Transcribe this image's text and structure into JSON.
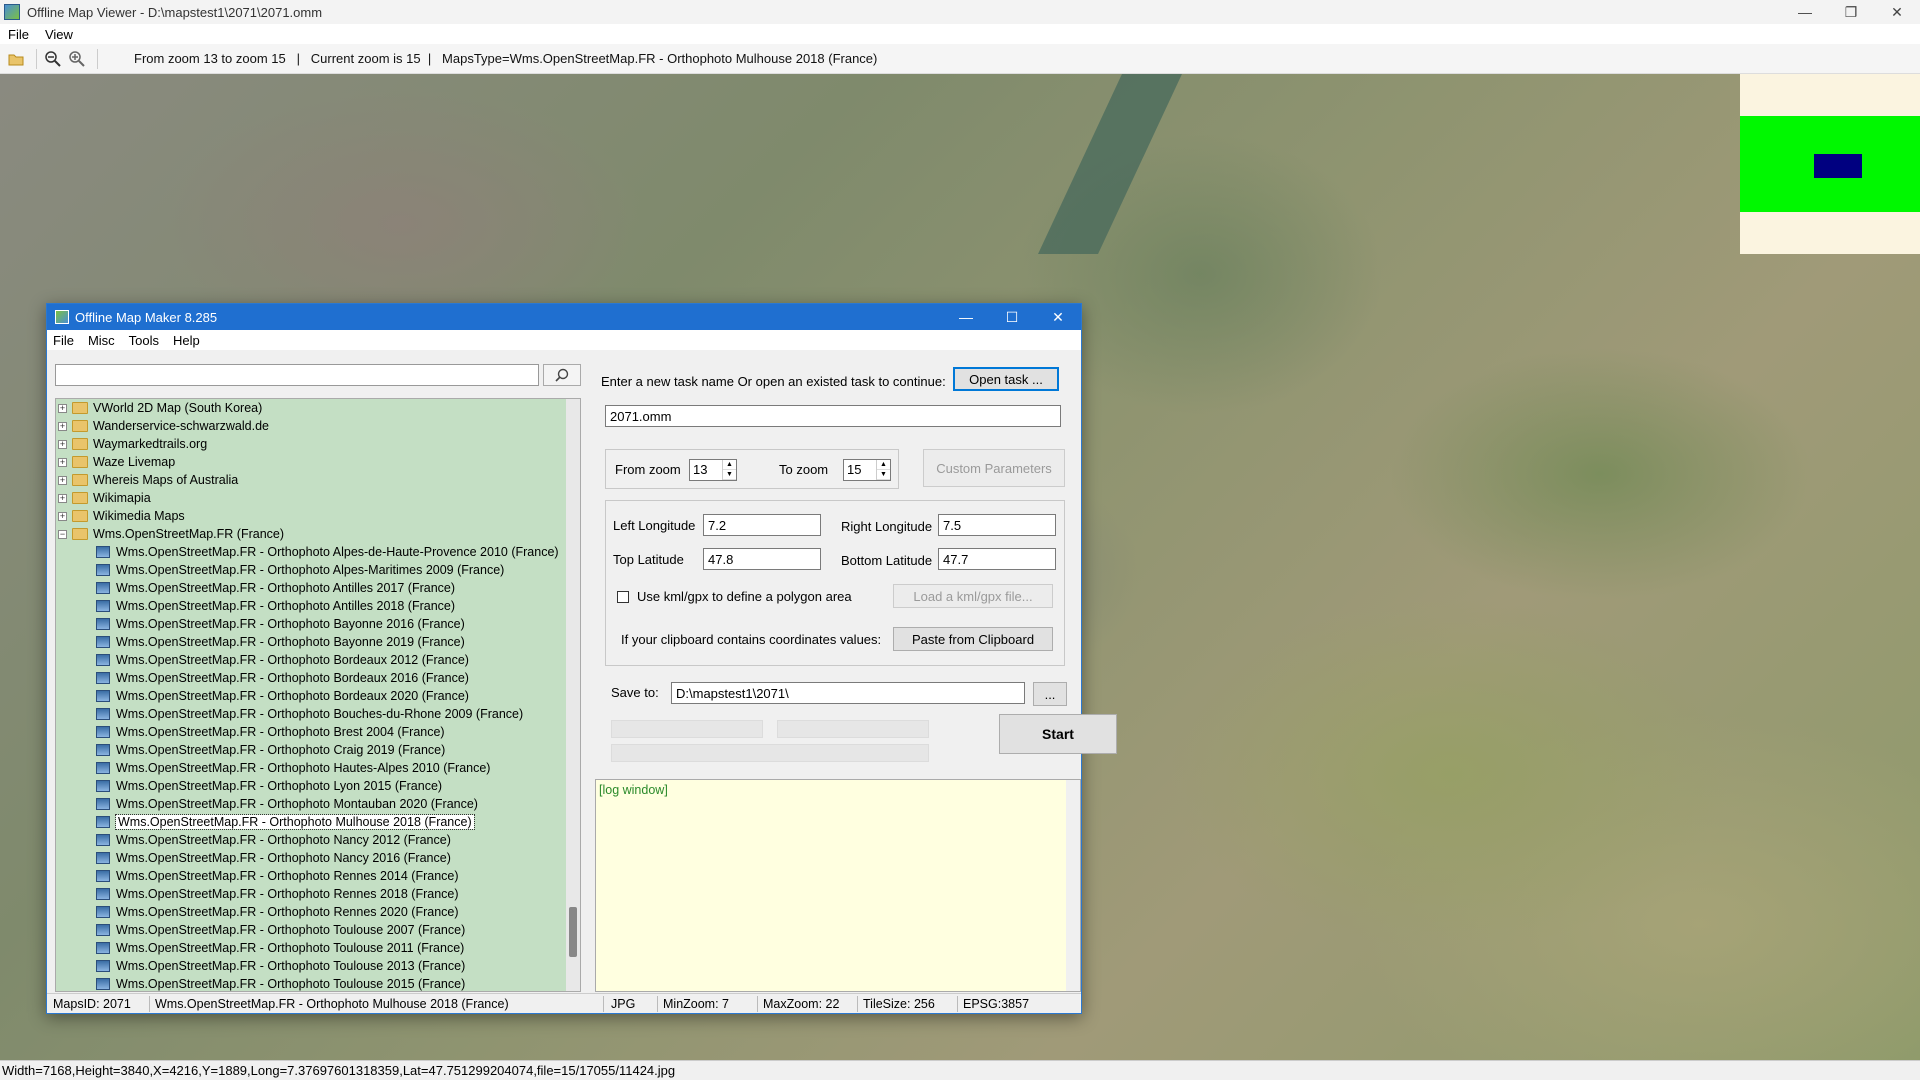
{
  "viewer": {
    "title": "Offline Map Viewer - D:\\mapstest1\\2071\\2071.omm",
    "menu": [
      "File",
      "View"
    ],
    "toolbar_text": "From zoom 13 to zoom 15   |   Current zoom is 15  |   MapsType=Wms.OpenStreetMap.FR - Orthophoto Mulhouse 2018 (France)",
    "status": "Width=7168,Height=3840,X=4216,Y=1889,Long=7.37697601318359,Lat=47.751299204074,file=15/17055/11424.jpg",
    "icons": [
      "open-folder-icon",
      "zoom-out-icon",
      "zoom-in-icon"
    ]
  },
  "dialog": {
    "title": "Offline Map Maker 8.285",
    "menu": [
      "File",
      "Misc",
      "Tools",
      "Help"
    ],
    "tree": {
      "folders": [
        "VWorld 2D Map (South Korea)",
        "Wanderservice-schwarzwald.de",
        "Waymarkedtrails.org",
        "Waze Livemap",
        "Whereis Maps of Australia",
        "Wikimapia",
        "Wikimedia Maps",
        "Wms.OpenStreetMap.FR (France)"
      ],
      "children": [
        "Wms.OpenStreetMap.FR - Orthophoto Alpes-de-Haute-Provence 2010 (France)",
        "Wms.OpenStreetMap.FR - Orthophoto Alpes-Maritimes 2009 (France)",
        "Wms.OpenStreetMap.FR - Orthophoto Antilles 2017 (France)",
        "Wms.OpenStreetMap.FR - Orthophoto Antilles 2018 (France)",
        "Wms.OpenStreetMap.FR - Orthophoto Bayonne 2016 (France)",
        "Wms.OpenStreetMap.FR - Orthophoto Bayonne 2019 (France)",
        "Wms.OpenStreetMap.FR - Orthophoto Bordeaux 2012 (France)",
        "Wms.OpenStreetMap.FR - Orthophoto Bordeaux 2016 (France)",
        "Wms.OpenStreetMap.FR - Orthophoto Bordeaux 2020 (France)",
        "Wms.OpenStreetMap.FR - Orthophoto Bouches-du-Rhone 2009 (France)",
        "Wms.OpenStreetMap.FR - Orthophoto Brest 2004 (France)",
        "Wms.OpenStreetMap.FR - Orthophoto Craig 2019 (France)",
        "Wms.OpenStreetMap.FR - Orthophoto Hautes-Alpes 2010 (France)",
        "Wms.OpenStreetMap.FR - Orthophoto Lyon 2015 (France)",
        "Wms.OpenStreetMap.FR - Orthophoto Montauban 2020 (France)",
        "Wms.OpenStreetMap.FR - Orthophoto Mulhouse 2018 (France)",
        "Wms.OpenStreetMap.FR - Orthophoto Nancy 2012 (France)",
        "Wms.OpenStreetMap.FR - Orthophoto Nancy 2016 (France)",
        "Wms.OpenStreetMap.FR - Orthophoto Rennes 2014 (France)",
        "Wms.OpenStreetMap.FR - Orthophoto Rennes 2018 (France)",
        "Wms.OpenStreetMap.FR - Orthophoto Rennes 2020 (France)",
        "Wms.OpenStreetMap.FR - Orthophoto Toulouse 2007 (France)",
        "Wms.OpenStreetMap.FR - Orthophoto Toulouse 2011 (France)",
        "Wms.OpenStreetMap.FR - Orthophoto Toulouse 2013 (France)",
        "Wms.OpenStreetMap.FR - Orthophoto Toulouse 2015 (France)"
      ],
      "selected": "Wms.OpenStreetMap.FR - Orthophoto Mulhouse 2018 (France)"
    },
    "task_label": "Enter a new task name Or open an existed task to continue:",
    "open_task_button": "Open task ...",
    "task_name": "2071.omm",
    "from_zoom_label": "From zoom",
    "from_zoom": "13",
    "to_zoom_label": "To zoom",
    "to_zoom": "15",
    "custom_params_button": "Custom Parameters",
    "left_lon_label": "Left Longitude",
    "left_lon": "7.2",
    "right_lon_label": "Right Longitude",
    "right_lon": "7.5",
    "top_lat_label": "Top Latitude",
    "top_lat": "47.8",
    "bottom_lat_label": "Bottom Latitude",
    "bottom_lat": "47.7",
    "kml_checkbox_label": "Use kml/gpx to define a polygon area",
    "load_kml_button": "Load a kml/gpx file...",
    "clipboard_label": "If your clipboard contains coordinates values:",
    "paste_button": "Paste from Clipboard",
    "save_to_label": "Save to:",
    "save_to": "D:\\mapstest1\\2071\\",
    "browse_button": "...",
    "start_button": "Start",
    "log_text": "[log window]",
    "status": {
      "maps_id": "MapsID: 2071",
      "maps_name": "Wms.OpenStreetMap.FR - Orthophoto Mulhouse 2018 (France)",
      "format": "JPG",
      "min_zoom": "MinZoom: 7",
      "max_zoom": "MaxZoom: 22",
      "tile_size": "TileSize: 256",
      "epsg": "EPSG:3857"
    }
  }
}
